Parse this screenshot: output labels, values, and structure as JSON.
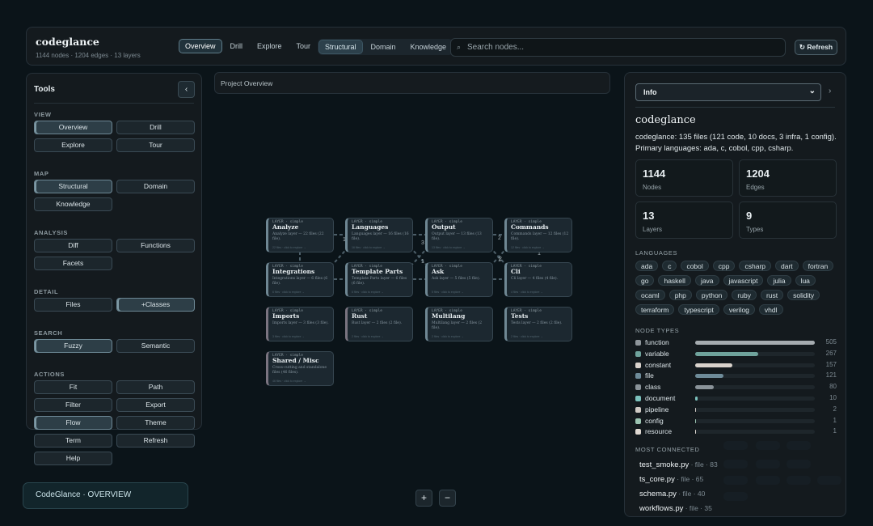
{
  "header": {
    "title": "codeglance",
    "subtitle": "1144 nodes · 1204 edges · 13 layers",
    "view_tabs": [
      "Overview",
      "Drill",
      "Explore",
      "Tour"
    ],
    "view_active": "Overview",
    "map_tabs": [
      "Structural",
      "Domain",
      "Knowledge"
    ],
    "map_active": "Structural",
    "search_placeholder": "Search nodes...",
    "refresh_label": "↻ Refresh"
  },
  "tools": {
    "title": "Tools",
    "collapse_icon": "‹",
    "sections": [
      {
        "label": "VIEW",
        "buttons": [
          {
            "label": "Overview",
            "active": true
          },
          {
            "label": "Drill"
          },
          {
            "label": "Explore"
          },
          {
            "label": "Tour"
          }
        ]
      },
      {
        "label": "MAP",
        "buttons": [
          {
            "label": "Structural",
            "active": true
          },
          {
            "label": "Domain"
          },
          {
            "label": "Knowledge"
          }
        ]
      },
      {
        "label": "ANALYSIS",
        "buttons": [
          {
            "label": "Diff"
          },
          {
            "label": "Functions"
          },
          {
            "label": "Facets"
          }
        ]
      },
      {
        "label": "DETAIL",
        "buttons": [
          {
            "label": "Files"
          },
          {
            "label": "+Classes",
            "active": true
          }
        ]
      },
      {
        "label": "SEARCH",
        "buttons": [
          {
            "label": "Fuzzy",
            "active": true
          },
          {
            "label": "Semantic"
          }
        ]
      },
      {
        "label": "ACTIONS",
        "buttons": [
          {
            "label": "Fit"
          },
          {
            "label": "Path"
          },
          {
            "label": "Filter"
          },
          {
            "label": "Export"
          },
          {
            "label": "Flow",
            "active": true
          },
          {
            "label": "Theme"
          },
          {
            "label": "Term"
          },
          {
            "label": "Refresh"
          },
          {
            "label": "Help"
          }
        ]
      }
    ]
  },
  "canvas": {
    "title": "Project Overview",
    "nodes": [
      {
        "label": "LAYER · simple",
        "title": "Analyze",
        "desc": "Analyze layer — 22 files (22 file).",
        "foot": "22 files · click to explore →",
        "accent": "#6f8793"
      },
      {
        "label": "LAYER · simple",
        "title": "Languages",
        "desc": "Languages layer — 16 files (16 file).",
        "foot": "16 files · click to explore →",
        "accent": "#6f8793"
      },
      {
        "label": "LAYER · simple",
        "title": "Output",
        "desc": "Output layer — 13 files (13 file).",
        "foot": "13 files · click to explore →",
        "accent": "#6f8793"
      },
      {
        "label": "LAYER · simple",
        "title": "Commands",
        "desc": "Commands layer — 12 files (12 file).",
        "foot": "12 files · click to explore →",
        "accent": "#6f8793"
      },
      {
        "label": "LAYER · simple",
        "title": "Integrations",
        "desc": "Integrations layer — 6 files (6 file).",
        "foot": "6 files · click to explore →",
        "accent": "#6f8793"
      },
      {
        "label": "LAYER · simple",
        "title": "Template Parts",
        "desc": "Template Parts layer — 6 files (6 file).",
        "foot": "6 files · click to explore →",
        "accent": "#6f8793"
      },
      {
        "label": "LAYER · simple",
        "title": "Ask",
        "desc": "Ask layer — 5 files (5 file).",
        "foot": "5 files · click to explore →",
        "accent": "#6f8793"
      },
      {
        "label": "LAYER · simple",
        "title": "Cli",
        "desc": "Cli layer — 4 files (4 file).",
        "foot": "4 files · click to explore →",
        "accent": "#6f8793"
      },
      {
        "label": "LAYER · simple",
        "title": "Imports",
        "desc": "Imports layer — 3 files (3 file).",
        "foot": "3 files · click to explore →",
        "accent": "#7a7480"
      },
      {
        "label": "LAYER · simple",
        "title": "Rust",
        "desc": "Rust layer — 2 files (2 file).",
        "foot": "2 files · click to explore →",
        "accent": "#7a7480"
      },
      {
        "label": "LAYER · simple",
        "title": "Multilang",
        "desc": "Multilang layer — 2 files (2 file).",
        "foot": "2 files · click to explore →",
        "accent": "#6f8793"
      },
      {
        "label": "LAYER · simple",
        "title": "Tests",
        "desc": "Tests layer — 2 files (2 file).",
        "foot": "2 files · click to explore →",
        "accent": "#6f8793"
      },
      {
        "label": "LAYER · simple",
        "title": "Shared / Misc",
        "desc": "Cross-cutting and standalone files (46 files).",
        "foot": "46 files · click to explore →",
        "accent": "#7a7480"
      }
    ],
    "edge_labels": [
      "1",
      "3",
      "2",
      "1",
      "2",
      "1",
      "1"
    ],
    "zoom_in": "+",
    "zoom_out": "−"
  },
  "status": {
    "text": "CodeGlance · OVERVIEW"
  },
  "info": {
    "select_value": "Info",
    "expand_icon": "›",
    "project_name": "codeglance",
    "description": "codeglance: 135 files (121 code, 10 docs, 3 infra, 1 config). Primary languages: ada, c, cobol, cpp, csharp.",
    "stats": [
      {
        "value": "1144",
        "label": "Nodes"
      },
      {
        "value": "1204",
        "label": "Edges"
      },
      {
        "value": "13",
        "label": "Layers"
      },
      {
        "value": "9",
        "label": "Types"
      }
    ],
    "languages_label": "LANGUAGES",
    "languages": [
      "ada",
      "c",
      "cobol",
      "cpp",
      "csharp",
      "dart",
      "fortran",
      "go",
      "haskell",
      "java",
      "javascript",
      "julia",
      "lua",
      "ocaml",
      "php",
      "python",
      "ruby",
      "rust",
      "solidity",
      "terraform",
      "typescript",
      "verilog",
      "vhdl"
    ],
    "node_types_label": "NODE TYPES",
    "node_types": [
      {
        "name": "function",
        "count": 505,
        "color": "#a6acb0",
        "swatch": "#8f969b"
      },
      {
        "name": "variable",
        "count": 267,
        "color": "#6fa39c",
        "swatch": "#6fa39c"
      },
      {
        "name": "constant",
        "count": 157,
        "color": "#d9d2cc",
        "swatch": "#d9d2cc"
      },
      {
        "name": "file",
        "count": 121,
        "color": "#6e8b99",
        "swatch": "#6e8b99"
      },
      {
        "name": "class",
        "count": 80,
        "color": "#8a9399",
        "swatch": "#8a9399"
      },
      {
        "name": "document",
        "count": 10,
        "color": "#7cc2bd",
        "swatch": "#7cc2bd"
      },
      {
        "name": "pipeline",
        "count": 2,
        "color": "#cfc9c4",
        "swatch": "#cfc9c4"
      },
      {
        "name": "config",
        "count": 1,
        "color": "#9cc4b2",
        "swatch": "#9cc4b2"
      },
      {
        "name": "resource",
        "count": 1,
        "color": "#e0d9d3",
        "swatch": "#e0d9d3"
      }
    ],
    "most_connected_label": "MOST CONNECTED",
    "most_connected": [
      {
        "name": "test_smoke.py",
        "meta": " · file · 83"
      },
      {
        "name": "ts_core.py",
        "meta": " · file · 65"
      },
      {
        "name": "schema.py",
        "meta": " · file · 40"
      },
      {
        "name": "workflows.py",
        "meta": " · file · 35"
      }
    ]
  }
}
